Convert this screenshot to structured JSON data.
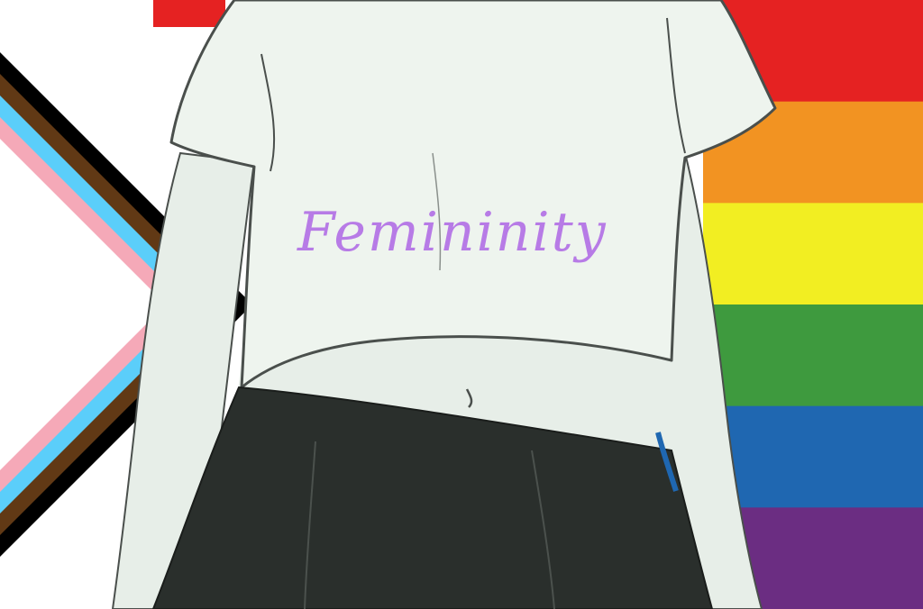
{
  "caption": {
    "text": "Femininity",
    "color": "#b77be6"
  },
  "flags": {
    "progress_pride_chevrons": [
      "#ffffff",
      "#f5a9b8",
      "#5bcefa",
      "#613915",
      "#000000"
    ],
    "rainbow_stripes": [
      "#e52222",
      "#f29322",
      "#f2ee22",
      "#3e9a3e",
      "#1f67b1",
      "#6b2d82"
    ]
  },
  "figure": {
    "shirt_color": "#eef4ee",
    "skin_color": "#e7eee8",
    "skirt_color": "#2a2f2c",
    "line_color": "#4a4f4c"
  }
}
